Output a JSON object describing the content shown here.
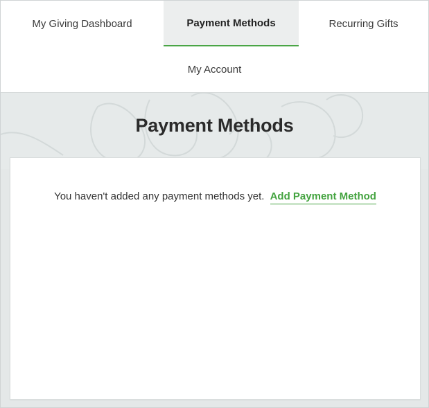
{
  "nav": {
    "tabs": [
      {
        "label": "My Giving Dashboard",
        "active": false
      },
      {
        "label": "Payment Methods",
        "active": true
      },
      {
        "label": "Recurring Gifts",
        "active": false
      },
      {
        "label": "My Account",
        "active": false
      }
    ],
    "active_underline_color": "#4aa546"
  },
  "hero": {
    "title": "Payment Methods",
    "background_icon": "hands-pattern-icon"
  },
  "card": {
    "empty_message": "You haven't added any payment methods yet.",
    "add_link_label": "Add Payment Method",
    "link_color": "#43a33f"
  }
}
